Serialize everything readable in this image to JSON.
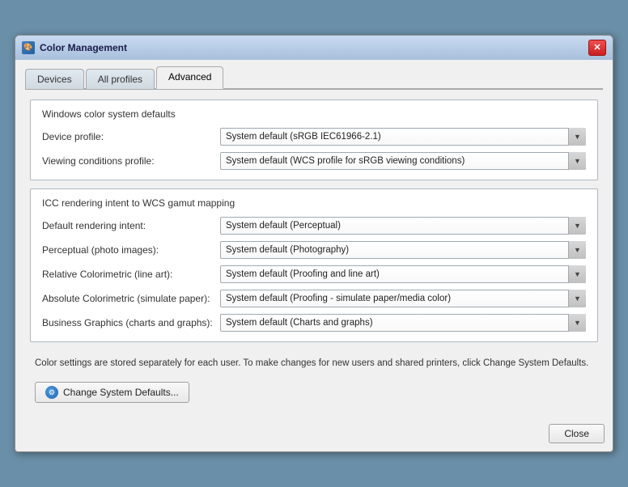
{
  "window": {
    "title": "Color Management",
    "icon_label": "CM",
    "close_label": "✕"
  },
  "tabs": [
    {
      "id": "devices",
      "label": "Devices",
      "active": false
    },
    {
      "id": "all-profiles",
      "label": "All profiles",
      "active": false
    },
    {
      "id": "advanced",
      "label": "Advanced",
      "active": true
    }
  ],
  "windows_color_section": {
    "title": "Windows color system defaults",
    "device_profile_label": "Device profile:",
    "device_profile_value": "System default (sRGB IEC61966-2.1)",
    "viewing_conditions_label": "Viewing conditions profile:",
    "viewing_conditions_value": "System default (WCS profile for sRGB viewing conditions)"
  },
  "icc_section": {
    "title": "ICC  rendering intent to WCS gamut mapping",
    "rows": [
      {
        "label": "Default rendering intent:",
        "value": "System default (Perceptual)"
      },
      {
        "label": "Perceptual (photo images):",
        "value": "System default (Photography)"
      },
      {
        "label": "Relative Colorimetric (line art):",
        "value": "System default (Proofing and line art)"
      },
      {
        "label": "Absolute Colorimetric (simulate paper):",
        "value": "System default (Proofing - simulate paper/media color)"
      },
      {
        "label": "Business Graphics (charts and graphs):",
        "value": "System default (Charts and graphs)"
      }
    ]
  },
  "info_text": "Color settings are stored separately for each user. To make changes for new users and shared printers, click Change System Defaults.",
  "change_defaults_button": "Change System Defaults...",
  "close_button": "Close"
}
